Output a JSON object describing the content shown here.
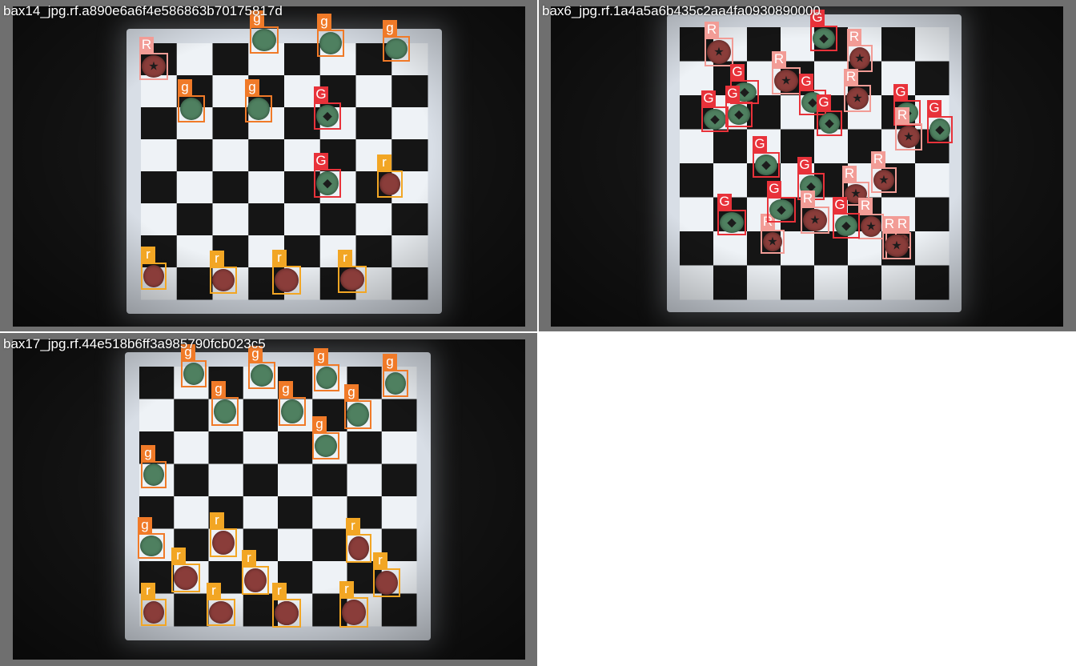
{
  "colors": {
    "label_g": "#f07a28",
    "label_G": "#e8323a",
    "label_r": "#f2a624",
    "label_R": "#f29c96",
    "piece_green": "#4f8060",
    "piece_red": "#8a3d3a"
  },
  "panels": [
    {
      "title": "bax14_jpg.rf.a890e6a6f4e586863b70175817d",
      "detections": [
        {
          "label": "R",
          "piece": "red",
          "mark": "star-icon"
        },
        {
          "label": "g",
          "piece": "green",
          "mark": "none"
        },
        {
          "label": "g",
          "piece": "green",
          "mark": "none"
        },
        {
          "label": "g",
          "piece": "green",
          "mark": "none"
        },
        {
          "label": "g",
          "piece": "green",
          "mark": "none"
        },
        {
          "label": "g",
          "piece": "green",
          "mark": "none"
        },
        {
          "label": "G",
          "piece": "green",
          "mark": "diamond-icon"
        },
        {
          "label": "G",
          "piece": "green",
          "mark": "diamond-icon"
        },
        {
          "label": "r",
          "piece": "red",
          "mark": "none"
        },
        {
          "label": "r",
          "piece": "red",
          "mark": "none"
        },
        {
          "label": "r",
          "piece": "red",
          "mark": "none"
        },
        {
          "label": "r",
          "piece": "red",
          "mark": "none"
        },
        {
          "label": "r",
          "piece": "red",
          "mark": "none"
        }
      ]
    },
    {
      "title": "bax6_jpg.rf.1a4a5a6b435c2aa4fa0930890000",
      "detections": [
        {
          "label": "G",
          "piece": "green",
          "mark": "diamond-icon"
        },
        {
          "label": "R",
          "piece": "red",
          "mark": "star-icon"
        },
        {
          "label": "R",
          "piece": "red",
          "mark": "star-icon"
        },
        {
          "label": "G",
          "piece": "green",
          "mark": "diamond-icon"
        },
        {
          "label": "R",
          "piece": "red",
          "mark": "star-icon"
        },
        {
          "label": "G",
          "piece": "green",
          "mark": "diamond-icon"
        },
        {
          "label": "R",
          "piece": "red",
          "mark": "star-icon"
        },
        {
          "label": "G",
          "piece": "green",
          "mark": "diamond-icon"
        },
        {
          "label": "G",
          "piece": "green",
          "mark": "diamond-icon"
        },
        {
          "label": "G",
          "piece": "green",
          "mark": "diamond-icon"
        },
        {
          "label": "G",
          "piece": "green",
          "mark": "diamond-icon"
        },
        {
          "label": "G",
          "piece": "green",
          "mark": "diamond-icon"
        },
        {
          "label": "R",
          "piece": "red",
          "mark": "star-icon"
        },
        {
          "label": "G",
          "piece": "green",
          "mark": "diamond-icon"
        },
        {
          "label": "G",
          "piece": "green",
          "mark": "diamond-icon"
        },
        {
          "label": "R",
          "piece": "red",
          "mark": "star-icon"
        },
        {
          "label": "R",
          "piece": "red",
          "mark": "star-icon"
        },
        {
          "label": "R",
          "piece": "red",
          "mark": "star-icon"
        },
        {
          "label": "G",
          "piece": "green",
          "mark": "diamond-icon"
        },
        {
          "label": "G",
          "piece": "green",
          "mark": "diamond-icon"
        },
        {
          "label": "R",
          "piece": "red",
          "mark": "star-icon"
        },
        {
          "label": "R",
          "piece": "red",
          "mark": "star-icon"
        },
        {
          "label": "G",
          "piece": "green",
          "mark": "diamond-icon"
        },
        {
          "label": "R",
          "piece": "red",
          "mark": "star-icon"
        },
        {
          "label": "R",
          "piece": "red",
          "mark": "star-icon"
        },
        {
          "label": "R",
          "piece": "red",
          "mark": "star-icon"
        }
      ]
    },
    {
      "title": "bax17_jpg.rf.44e518b6ff3a985790fcb023c5",
      "detections": [
        {
          "label": "g",
          "piece": "green",
          "mark": "none"
        },
        {
          "label": "g",
          "piece": "green",
          "mark": "none"
        },
        {
          "label": "g",
          "piece": "green",
          "mark": "none"
        },
        {
          "label": "g",
          "piece": "green",
          "mark": "none"
        },
        {
          "label": "g",
          "piece": "green",
          "mark": "none"
        },
        {
          "label": "g",
          "piece": "green",
          "mark": "none"
        },
        {
          "label": "g",
          "piece": "green",
          "mark": "none"
        },
        {
          "label": "g",
          "piece": "green",
          "mark": "none"
        },
        {
          "label": "g",
          "piece": "green",
          "mark": "none"
        },
        {
          "label": "g",
          "piece": "green",
          "mark": "none"
        },
        {
          "label": "r",
          "piece": "red",
          "mark": "none"
        },
        {
          "label": "r",
          "piece": "red",
          "mark": "none"
        },
        {
          "label": "r",
          "piece": "red",
          "mark": "none"
        },
        {
          "label": "r",
          "piece": "red",
          "mark": "none"
        },
        {
          "label": "r",
          "piece": "red",
          "mark": "none"
        },
        {
          "label": "r",
          "piece": "red",
          "mark": "none"
        },
        {
          "label": "r",
          "piece": "red",
          "mark": "none"
        },
        {
          "label": "r",
          "piece": "red",
          "mark": "none"
        },
        {
          "label": "r",
          "piece": "red",
          "mark": "none"
        },
        {
          "label": "r",
          "piece": "red",
          "mark": "none"
        }
      ]
    }
  ]
}
